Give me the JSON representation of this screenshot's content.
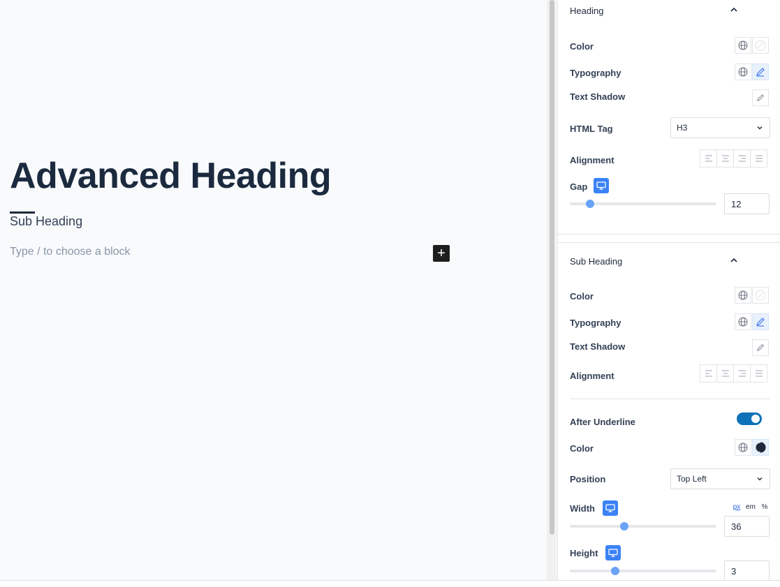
{
  "canvas": {
    "heading": "Advanced Heading",
    "sub_heading": "Sub Heading",
    "placeholder": "Type / to choose a block",
    "add_block": "+"
  },
  "heading_section": {
    "title": "Heading",
    "color_label": "Color",
    "typography_label": "Typography",
    "text_shadow_label": "Text Shadow",
    "html_tag_label": "HTML Tag",
    "html_tag_value": "H3",
    "alignment_label": "Alignment",
    "gap_label": "Gap",
    "gap_value": "12",
    "gap_fraction": 0.14
  },
  "sub_heading_section": {
    "title": "Sub Heading",
    "color_label": "Color",
    "typography_label": "Typography",
    "text_shadow_label": "Text Shadow",
    "alignment_label": "Alignment",
    "after_underline_label": "After Underline",
    "after_underline_on": true,
    "underline_color_label": "Color",
    "position_label": "Position",
    "position_value": "Top Left",
    "width_label": "Width",
    "width_value": "36",
    "width_fraction": 0.37,
    "units": [
      "px",
      "em",
      "%"
    ],
    "active_unit": "px",
    "height_label": "Height",
    "height_value": "3",
    "height_fraction": 0.31
  },
  "colors": {
    "accent": "#3b82f6",
    "toggle": "#0e72b8",
    "heading_text": "#1b2a3e"
  },
  "icons": [
    "globe-icon",
    "pencil-icon",
    "chevron-up-icon",
    "chevron-down-icon",
    "monitor-icon",
    "align-left-icon",
    "align-center-icon",
    "align-right-icon",
    "align-justify-icon",
    "plus-icon"
  ]
}
